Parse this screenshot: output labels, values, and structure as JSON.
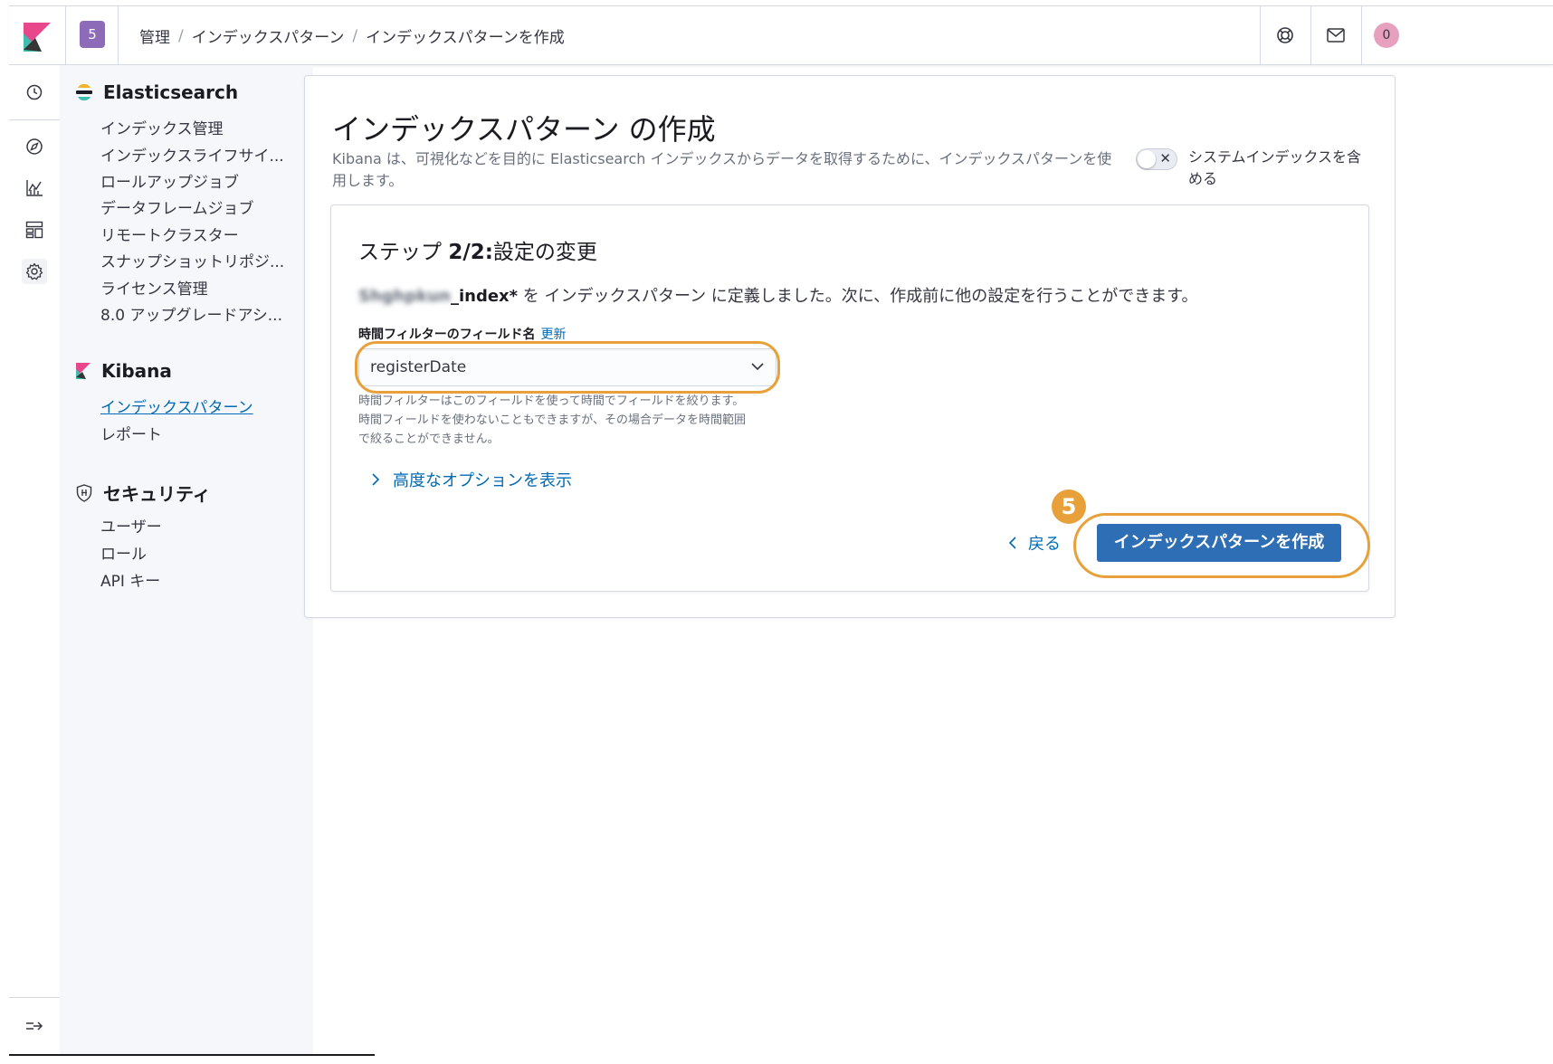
{
  "header": {
    "space_badge": "5",
    "breadcrumbs": [
      "管理",
      "インデックスパターン",
      "インデックスパターンを作成"
    ],
    "avatar_initial": "0"
  },
  "sidenav": {
    "elasticsearch": {
      "title": "Elasticsearch",
      "items": [
        "インデックス管理",
        "インデックスライフサイ...",
        "ロールアップジョブ",
        "データフレームジョブ",
        "リモートクラスター",
        "スナップショットリポジ...",
        "ライセンス管理",
        "8.0 アップグレードアシ..."
      ]
    },
    "kibana": {
      "title": "Kibana",
      "items": [
        "インデックスパターン",
        "レポート"
      ]
    },
    "security": {
      "title": "セキュリティ",
      "items": [
        "ユーザー",
        "ロール",
        "API キー"
      ]
    }
  },
  "page": {
    "title": "インデックスパターン の作成",
    "description": "Kibana は、可視化などを目的に Elasticsearch インデックスからデータを取得するために、インデックスパターンを使用します。",
    "system_toggle_label": "システムインデックスを含める",
    "step": {
      "title_prefix": "ステップ",
      "title_step": "2/2:",
      "title_rest": "設定の変更",
      "pattern_blurred": "Shghpkun",
      "pattern_suffix": "_index*",
      "message": " を インデックスパターン に定義しました。次に、作成前に他の設定を行うことができます。",
      "field_label": "時間フィルターのフィールド名",
      "refresh_link": "更新",
      "selected_field": "registerDate",
      "help_line1": "時間フィルターはこのフィールドを使って時間でフィールドを絞ります。",
      "help_line2": "時間フィールドを使わないこともできますが、その場合データを時間範囲",
      "help_line3": "で絞ることができません。",
      "advanced_label": "高度なオプションを表示",
      "back_label": "戻る",
      "create_label": "インデックスパターンを作成",
      "callout_number": "5"
    }
  },
  "colors": {
    "accent": "#006bb4",
    "primary_button": "#2d6eb5",
    "highlight": "#e8a13a",
    "space_badge": "#8e6bb8",
    "avatar": "#e7a0bd"
  },
  "icons": [
    "kibana-logo",
    "help-icon",
    "mail-icon",
    "clock-icon",
    "compass-icon",
    "chart-icon",
    "dashboard-icon",
    "gear-icon",
    "collapse-icon",
    "elasticsearch-icon",
    "kibana-icon",
    "security-shield-icon",
    "chevron-down-icon",
    "chevron-right-icon",
    "chevron-left-icon"
  ]
}
